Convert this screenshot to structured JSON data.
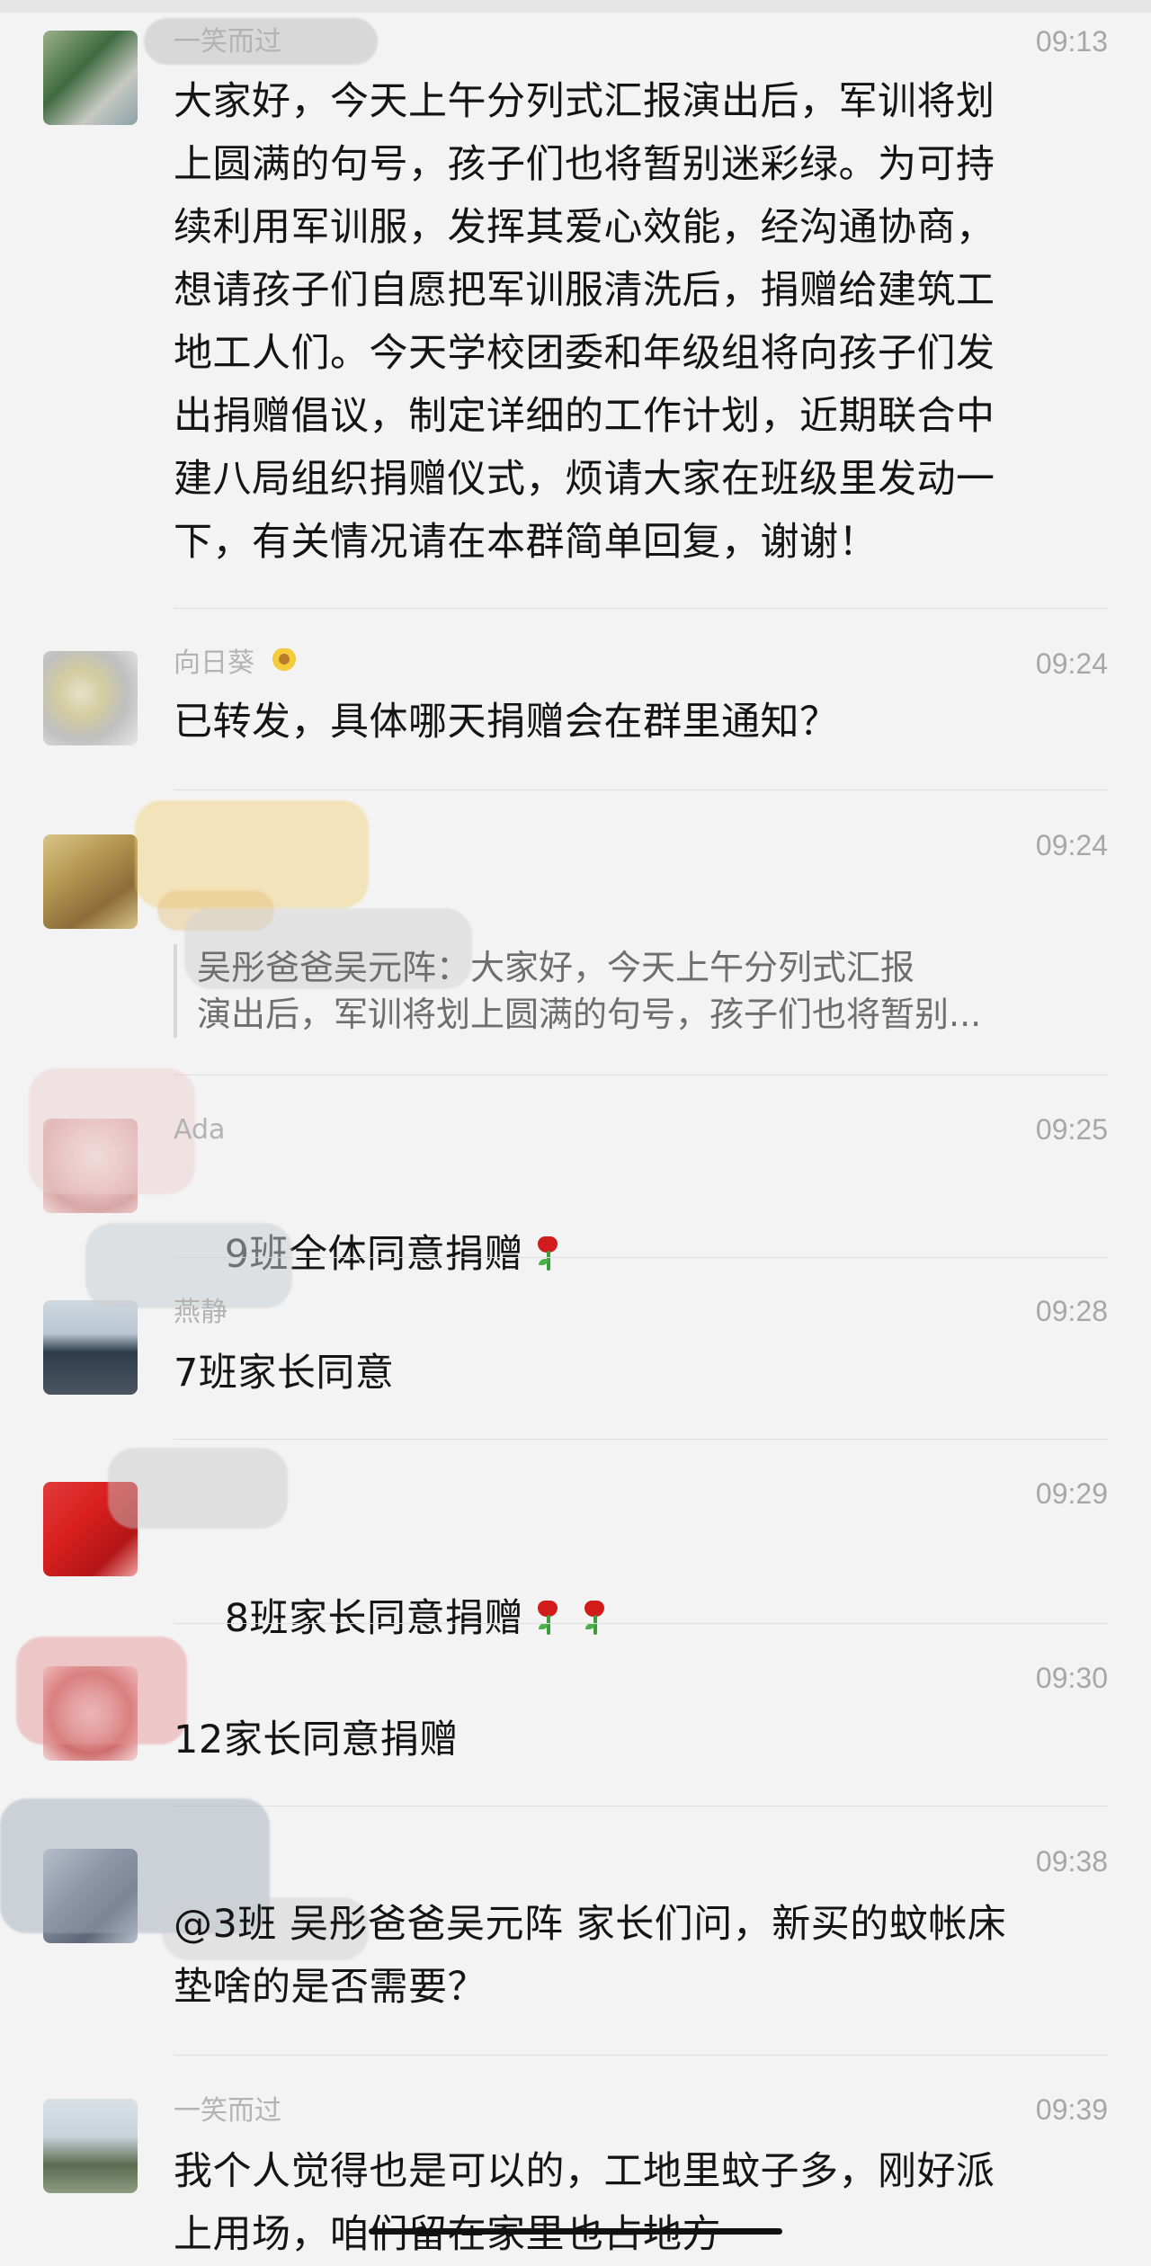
{
  "messages": [
    {
      "name": "一笑而过",
      "time": "09:13",
      "text": "大家好，今天上午分列式汇报演出后，军训将划\n上圆满的句号，孩子们也将暂别迷彩绿。为可持\n续利用军训服，发挥其爱心效能，经沟通协商，\n想请孩子们自愿把军训服清洗后，捐赠给建筑工\n地工人们。今天学校团委和年级组将向孩子们发\n出捐赠倡议，制定详细的工作计划，近期联合中\n建八局组织捐赠仪式，烦请大家在班级里发动一\n下，有关情况请在本群简单回复，谢谢！"
    },
    {
      "name": "向日葵",
      "time": "09:24",
      "text": "已转发，具体哪天捐赠会在群里通知？"
    },
    {
      "name": "",
      "time": "09:24",
      "quote": "吴彤爸爸吴元阵：大家好，今天上午分列式汇报\n演出后，军训将划上圆满的句号，孩子们也将暂别..."
    },
    {
      "name": "Ada",
      "time": "09:25",
      "text": "9班全体同意捐赠"
    },
    {
      "name": "燕静",
      "time": "09:28",
      "text": "7班家长同意"
    },
    {
      "name": "",
      "time": "09:29",
      "text": "8班家长同意捐赠"
    },
    {
      "name": "",
      "time": "09:30",
      "text": "12家长同意捐赠"
    },
    {
      "name": "",
      "time": "09:38",
      "text": "@3班 吴彤爸爸吴元阵 家长们问，新买的蚊帐床\n垫啥的是否需要？"
    },
    {
      "name": "一笑而过",
      "time": "09:39",
      "text": "我个人觉得也是可以的，工地里蚊子多，刚好派\n上用场，咱们留在家里也占地方"
    }
  ],
  "icons": {
    "rose": "rose-emoji-icon",
    "sunflower": "sunflower-emoji-icon"
  }
}
